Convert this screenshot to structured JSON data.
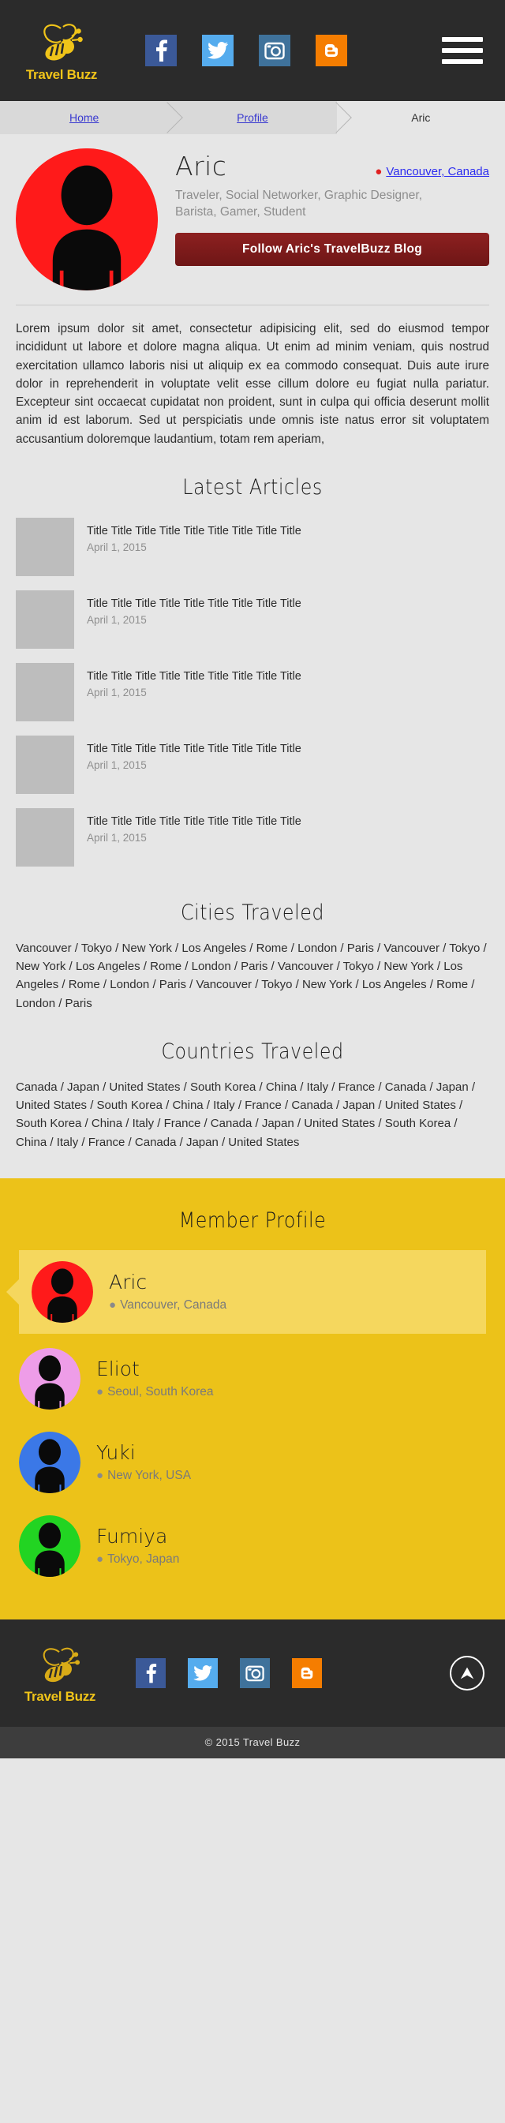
{
  "brand": {
    "name": "Travel Buzz",
    "logo_icon": "bee-icon",
    "accent": "#f0c419"
  },
  "header": {
    "social": [
      {
        "icon": "facebook-icon",
        "glyph": "f",
        "color": "#3b5998",
        "cls": "fb"
      },
      {
        "icon": "twitter-icon",
        "glyph": "\u0000",
        "color": "#55acee",
        "cls": "tw"
      },
      {
        "icon": "instagram-icon",
        "glyph": "\u0000",
        "color": "#3f729b",
        "cls": "ig"
      },
      {
        "icon": "blogger-icon",
        "glyph": "B",
        "color": "#f57d00",
        "cls": "bl"
      }
    ],
    "menu_icon": "hamburger-menu-icon"
  },
  "breadcrumb": [
    {
      "label": "Home",
      "current": false
    },
    {
      "label": "Profile",
      "current": false
    },
    {
      "label": "Aric",
      "current": true
    }
  ],
  "profile": {
    "name": "Aric",
    "location": "Vancouver, Canada",
    "location_icon": "map-pin-icon",
    "tags": "Traveler, Social Networker, Graphic Designer, Barista, Gamer, Student",
    "follow_label": "Follow Aric's TravelBuzz Blog",
    "avatar_color": "#ff1a1a",
    "bio": "Lorem ipsum dolor sit amet, consectetur adipisicing elit, sed do eiusmod tempor incididunt ut labore et dolore magna aliqua. Ut enim ad minim veniam, quis nostrud exercitation ullamco laboris nisi ut aliquip ex ea commodo consequat. Duis aute irure dolor in reprehenderit in voluptate velit esse cillum dolore eu fugiat nulla pariatur. Excepteur sint occaecat cupidatat non proident, sunt in culpa qui officia deserunt mollit anim id est laborum. Sed ut perspiciatis unde omnis iste natus error sit voluptatem accusantium doloremque laudantium, totam rem aperiam,"
  },
  "articles": {
    "heading": "Latest Articles",
    "items": [
      {
        "title": "Title Title Title Title Title Title Title Title Title",
        "date": "April 1, 2015"
      },
      {
        "title": "Title Title Title Title Title Title Title Title Title",
        "date": "April 1, 2015"
      },
      {
        "title": "Title Title Title Title Title Title Title Title Title",
        "date": "April 1, 2015"
      },
      {
        "title": "Title Title Title Title Title Title Title Title Title",
        "date": "April 1, 2015"
      },
      {
        "title": "Title Title Title Title Title Title Title Title Title",
        "date": "April 1, 2015"
      }
    ]
  },
  "cities": {
    "heading": "Cities Traveled",
    "text": "Vancouver / Tokyo / New York / Los Angeles / Rome / London / Paris / Vancouver / Tokyo / New York / Los Angeles / Rome / London / Paris / Vancouver / Tokyo / New York / Los Angeles / Rome / London / Paris / Vancouver / Tokyo / New York / Los Angeles / Rome / London / Paris"
  },
  "countries": {
    "heading": "Countries Traveled",
    "text": "Canada / Japan / United States / South Korea / China / Italy / France / Canada / Japan / United States / South Korea / China / Italy / France / Canada / Japan / United States / South Korea / China / Italy / France / Canada / Japan / United States / South Korea / China / Italy / France / Canada / Japan / United States"
  },
  "members": {
    "heading": "Member Profile",
    "bg_color": "#ecc219",
    "active_bg_color": "#f5d75e",
    "items": [
      {
        "name": "Aric",
        "location": "Vancouver, Canada",
        "avatar_color": "#ff1a1a",
        "active": true
      },
      {
        "name": "Eliot",
        "location": "Seoul, South Korea",
        "avatar_color": "#ee9de8",
        "active": false
      },
      {
        "name": "Yuki",
        "location": "New York, USA",
        "avatar_color": "#3b78e7",
        "active": false
      },
      {
        "name": "Fumiya",
        "location": "Tokyo, Japan",
        "avatar_color": "#22d422",
        "active": false
      }
    ]
  },
  "footer": {
    "social": [
      {
        "icon": "facebook-icon",
        "cls": "fb"
      },
      {
        "icon": "twitter-icon",
        "cls": "tw"
      },
      {
        "icon": "instagram-icon",
        "cls": "ig"
      },
      {
        "icon": "blogger-icon",
        "cls": "bl"
      }
    ],
    "back_to_top_icon": "arrow-up-circle-icon",
    "copyright": "© 2015 Travel Buzz"
  }
}
